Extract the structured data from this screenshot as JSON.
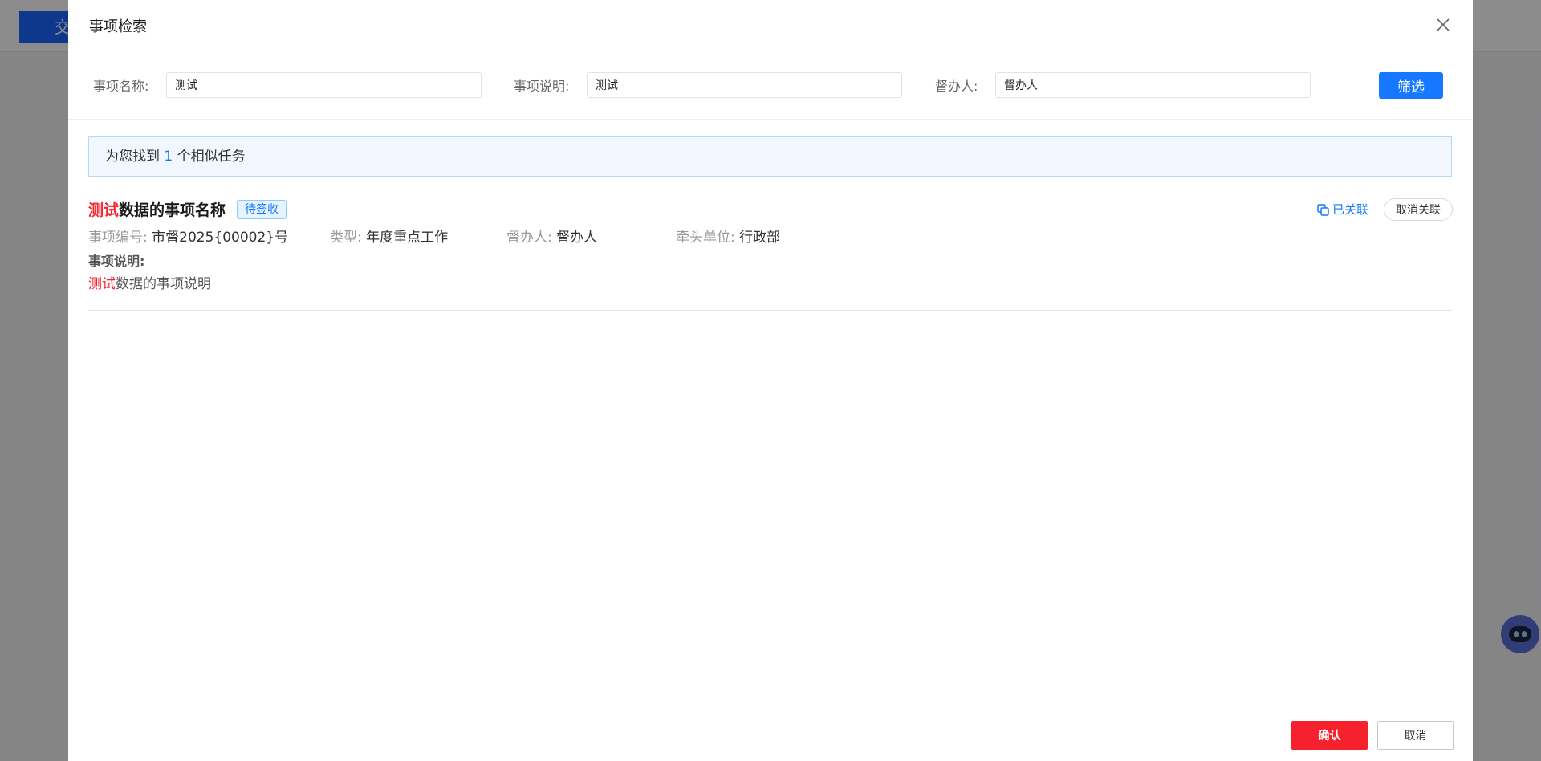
{
  "background": {
    "header_tab_label": "交"
  },
  "modal": {
    "title": "事项检索",
    "close_icon": "close-icon"
  },
  "filter": {
    "name_label": "事项名称:",
    "name_value": "测试",
    "desc_label": "事项说明:",
    "desc_value": "测试",
    "supervisor_label": "督办人:",
    "supervisor_value": "督办人",
    "filter_button": "筛选"
  },
  "banner": {
    "prefix": "为您找到",
    "count": "1",
    "suffix": "个相似任务"
  },
  "results": [
    {
      "title_highlight": "测试",
      "title_rest": "数据的事项名称",
      "status": "待签收",
      "linked_label": "已关联",
      "unlink_label": "取消关联",
      "number_label": "事项编号:",
      "number_value": "市督2025{00002}号",
      "type_label": "类型:",
      "type_value": "年度重点工作",
      "supervisor_label": "督办人:",
      "supervisor_value": "督办人",
      "dept_label": "牵头单位:",
      "dept_value": "行政部",
      "desc_label": "事项说明:",
      "desc_highlight": "测试",
      "desc_rest": "数据的事项说明"
    }
  ],
  "footer": {
    "confirm": "确认",
    "cancel": "取消"
  },
  "colors": {
    "primary": "#1677ff",
    "danger": "#f5222d",
    "overlay": "rgba(0,0,0,0.45)"
  }
}
